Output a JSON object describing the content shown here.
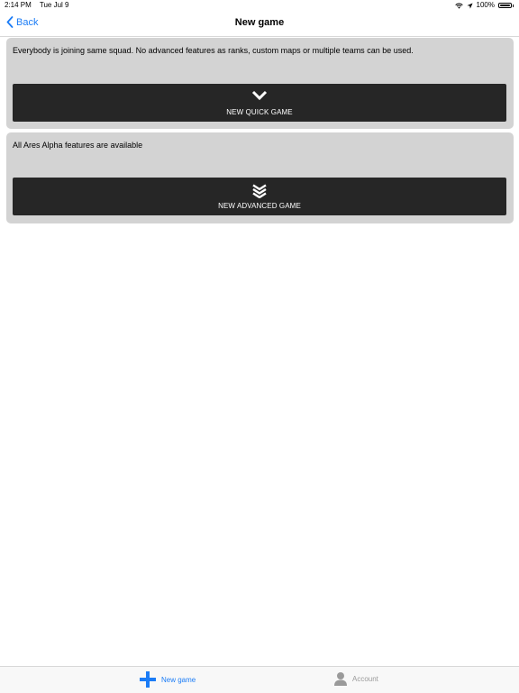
{
  "status_bar": {
    "time": "2:14 PM",
    "date": "Tue Jul 9",
    "battery": "100%"
  },
  "nav": {
    "back_label": "Back",
    "title": "New game"
  },
  "cards": [
    {
      "description": "Everybody is joining same squad. No advanced features as ranks, custom maps or multiple teams can be used.",
      "button_label": "NEW QUICK GAME",
      "icon": "chevron-down-icon"
    },
    {
      "description": "All Ares Alpha features are available",
      "button_label": "NEW ADVANCED GAME",
      "icon": "triple-chevron-down-icon"
    }
  ],
  "tabs": [
    {
      "label": "New game",
      "icon": "plus-icon",
      "active": true
    },
    {
      "label": "Account",
      "icon": "person-icon",
      "active": false
    }
  ],
  "colors": {
    "accent": "#1b7cf6",
    "card_bg": "#d3d3d3",
    "button_bg": "#262626",
    "inactive_tab": "#9a9a9a"
  }
}
